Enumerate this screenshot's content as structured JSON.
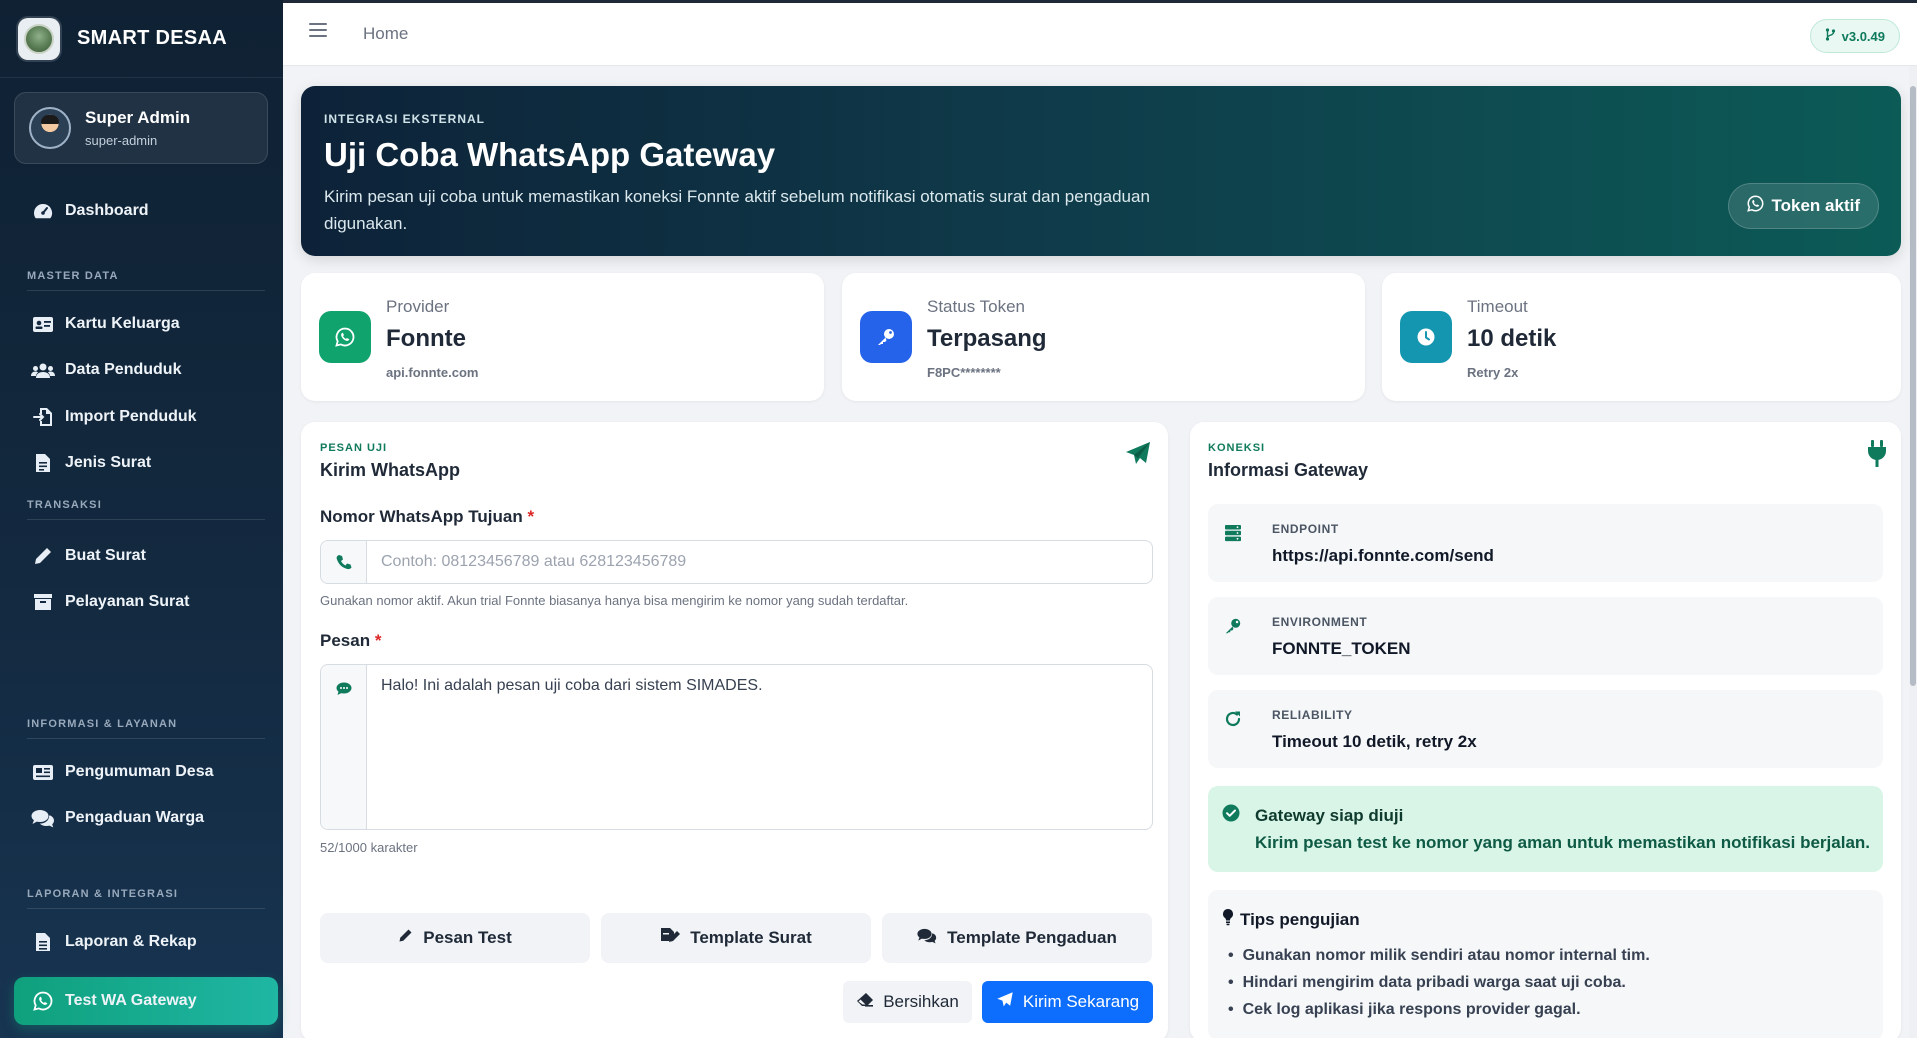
{
  "brand": {
    "name": "SMART DESAA"
  },
  "user": {
    "name": "Super Admin",
    "role": "super-admin"
  },
  "nav": {
    "dashboard": "Dashboard",
    "section_master": "MASTER DATA",
    "kartu_keluarga": "Kartu Keluarga",
    "data_penduduk": "Data Penduduk",
    "import_penduduk": "Import Penduduk",
    "jenis_surat": "Jenis Surat",
    "section_transaksi": "TRANSAKSI",
    "buat_surat": "Buat Surat",
    "pelayanan_surat": "Pelayanan Surat",
    "section_informasi": "INFORMASI & LAYANAN",
    "pengumuman_desa": "Pengumuman Desa",
    "pengaduan_warga": "Pengaduan Warga",
    "section_laporan": "LAPORAN & INTEGRASI",
    "laporan_rekap": "Laporan & Rekap",
    "test_wa_gateway": "Test WA Gateway"
  },
  "topbar": {
    "breadcrumb": "Home",
    "version": "v3.0.49"
  },
  "hero": {
    "eyebrow": "INTEGRASI EKSTERNAL",
    "title": "Uji Coba WhatsApp Gateway",
    "subtitle": "Kirim pesan uji coba untuk memastikan koneksi Fonnte aktif sebelum notifikasi otomatis surat dan pengaduan digunakan.",
    "token_status": "Token aktif"
  },
  "stats": {
    "provider": {
      "label": "Provider",
      "value": "Fonnte",
      "sub": "api.fonnte.com"
    },
    "token": {
      "label": "Status Token",
      "value": "Terpasang",
      "sub": "F8PC********"
    },
    "timeout": {
      "label": "Timeout",
      "value": "10 detik",
      "sub": "Retry 2x"
    }
  },
  "form": {
    "eyebrow": "PESAN UJI",
    "title": "Kirim WhatsApp",
    "phone_label": "Nomor WhatsApp Tujuan",
    "required_mark": "*",
    "phone_placeholder": "Contoh: 08123456789 atau 628123456789",
    "phone_help": "Gunakan nomor aktif. Akun trial Fonnte biasanya hanya bisa mengirim ke nomor yang sudah terdaftar.",
    "message_label": "Pesan",
    "message_value": "Halo! Ini adalah pesan uji coba dari sistem SIMADES.",
    "char_count": "52/1000 karakter",
    "template_test": "Pesan Test",
    "template_surat": "Template Surat",
    "template_pengaduan": "Template Pengaduan",
    "clear": "Bersihkan",
    "send": "Kirim Sekarang"
  },
  "gateway": {
    "eyebrow": "KONEKSI",
    "title": "Informasi Gateway",
    "endpoint_label": "ENDPOINT",
    "endpoint_value": "https://api.fonnte.com/send",
    "environment_label": "ENVIRONMENT",
    "environment_value": "FONNTE_TOKEN",
    "reliability_label": "RELIABILITY",
    "reliability_value": "Timeout 10 detik, retry 2x",
    "ready_title": "Gateway siap diuji",
    "ready_sub": "Kirim pesan test ke nomor yang aman untuk memastikan notifikasi berjalan.",
    "tips_title": "Tips pengujian",
    "tips": [
      "Gunakan nomor milik sendiri atau nomor internal tim.",
      "Hindari mengirim data pribadi warga saat uji coba.",
      "Cek log aplikasi jika respons provider gagal."
    ]
  },
  "colors": {
    "sidebar_bg": "#13293f",
    "accent_green": "#0f7a5c",
    "active_nav": "#0fa07d",
    "provider_icon": "#10a36e",
    "token_icon": "#2563eb",
    "timeout_icon": "#1596b0",
    "primary_button": "#0d6efd",
    "ready_bg": "#d8f5e7"
  },
  "icons": {
    "provider": "whatsapp-icon",
    "token": "key-icon",
    "timeout": "clock-icon",
    "send_panel": "paper-plane-icon",
    "gateway_panel": "plug-icon"
  }
}
